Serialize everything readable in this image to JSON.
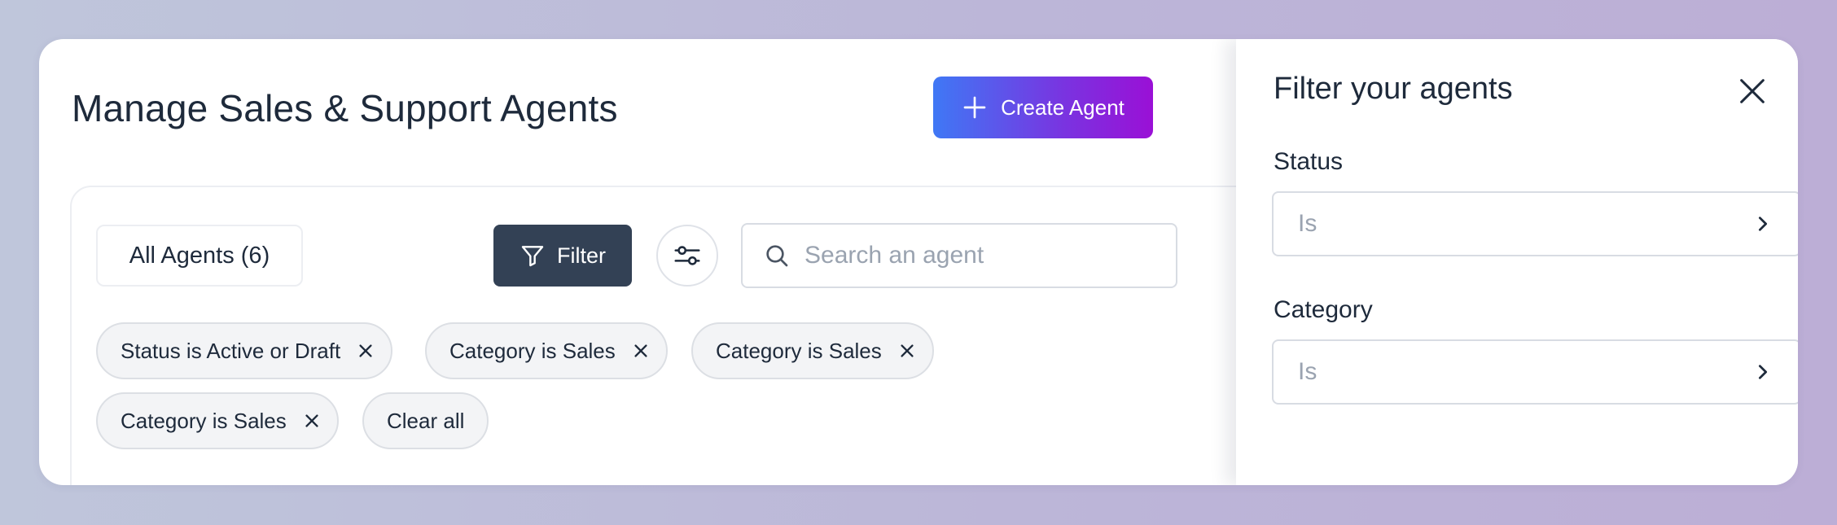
{
  "header": {
    "title": "Manage Sales & Support Agents",
    "create_label": "Create Agent"
  },
  "toolbar": {
    "all_agents_label": "All Agents (6)",
    "filter_label": "Filter",
    "search_placeholder": "Search an agent"
  },
  "active_filters": [
    {
      "label": "Status is Active or Draft"
    },
    {
      "label": "Category is Sales"
    },
    {
      "label": "Category is Sales"
    },
    {
      "label": "Category is Sales"
    }
  ],
  "clear_all_label": "Clear all",
  "drawer": {
    "title": "Filter your agents",
    "fields": [
      {
        "label": "Status",
        "placeholder": "Is"
      },
      {
        "label": "Category",
        "placeholder": "Is"
      }
    ]
  },
  "colors": {
    "filter_button": "#334155",
    "create_gradient_start": "#3f78f5",
    "create_gradient_end": "#9a10d6"
  }
}
